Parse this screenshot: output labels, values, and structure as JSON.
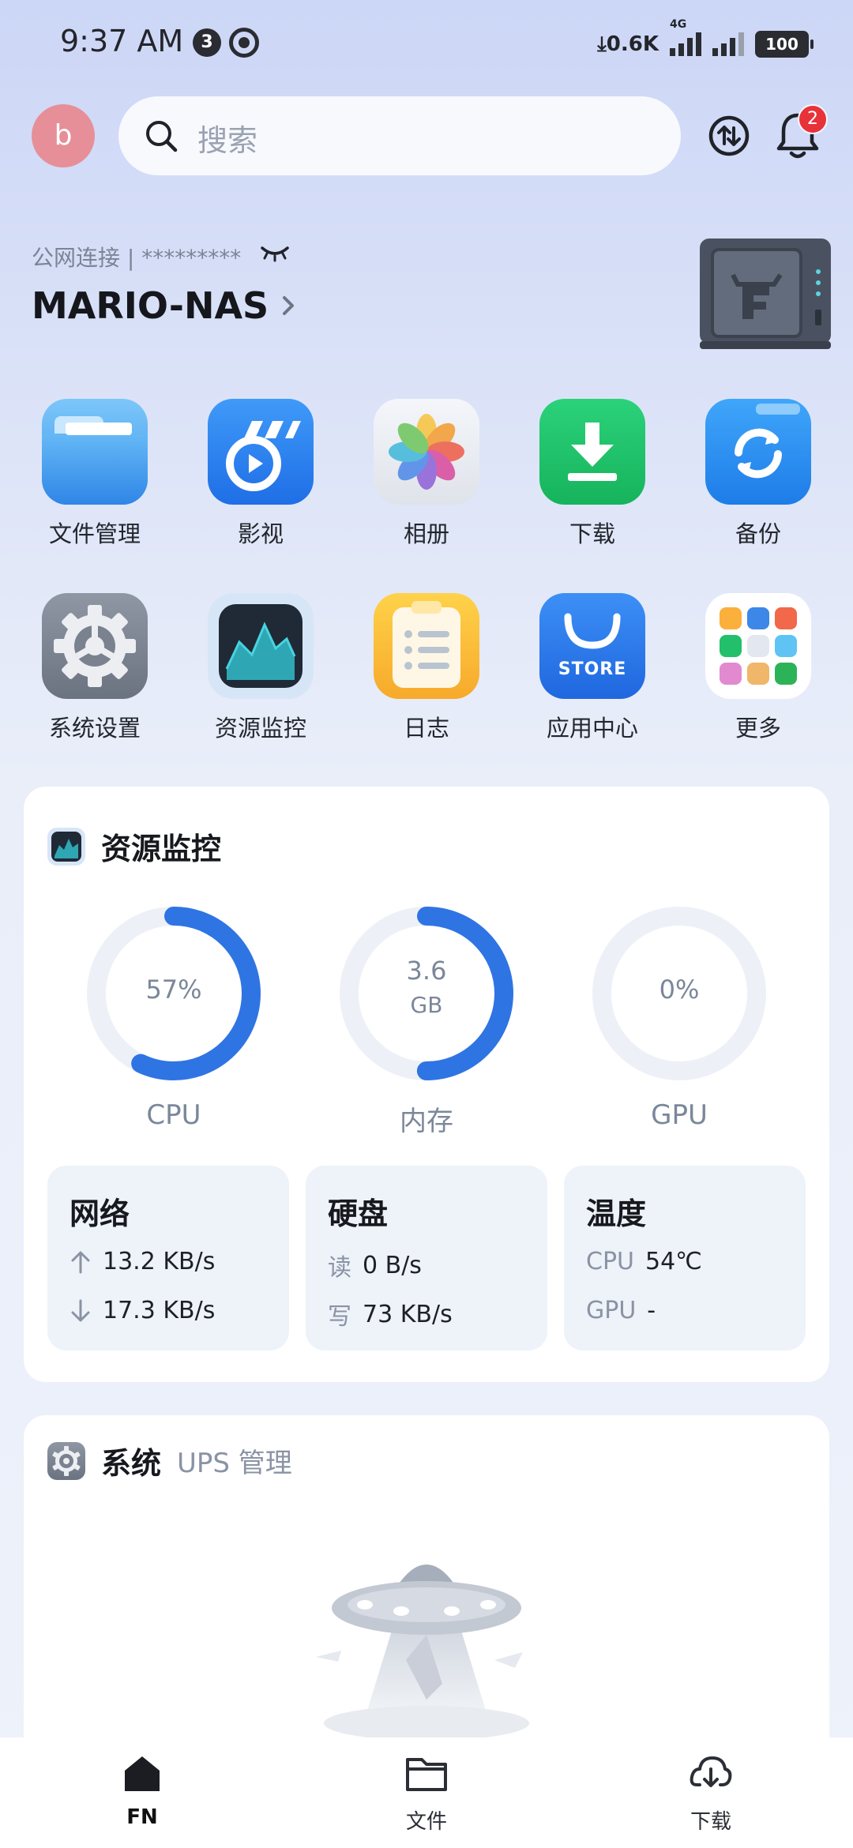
{
  "status_bar": {
    "time": "9:37 AM",
    "notif_count": "3",
    "net_speed": "0.6K",
    "network_type": "4G",
    "battery": "100"
  },
  "header": {
    "avatar_letter": "b",
    "search_placeholder": "搜索",
    "notification_count": "2"
  },
  "device": {
    "connection_label": "公网连接 | *********",
    "name": "MARIO-NAS"
  },
  "apps": [
    {
      "label": "文件管理",
      "icon": "folder-icon"
    },
    {
      "label": "影视",
      "icon": "video-icon"
    },
    {
      "label": "相册",
      "icon": "photos-icon"
    },
    {
      "label": "下载",
      "icon": "download-icon"
    },
    {
      "label": "备份",
      "icon": "backup-icon"
    },
    {
      "label": "系统设置",
      "icon": "settings-icon"
    },
    {
      "label": "资源监控",
      "icon": "monitor-icon"
    },
    {
      "label": "日志",
      "icon": "log-icon"
    },
    {
      "label": "应用中心",
      "icon": "store-icon",
      "badge_text": "STORE"
    },
    {
      "label": "更多",
      "icon": "more-icon"
    }
  ],
  "resource_monitor": {
    "title": "资源监控",
    "gauges": [
      {
        "label": "CPU",
        "value_text": "57%",
        "fraction": 0.57
      },
      {
        "label": "内存",
        "value_line1": "3.6",
        "value_line2": "GB",
        "fraction": 0.5
      },
      {
        "label": "GPU",
        "value_text": "0%",
        "fraction": 0.0
      }
    ],
    "network": {
      "title": "网络",
      "up": "13.2 KB/s",
      "down": "17.3 KB/s"
    },
    "disk": {
      "title": "硬盘",
      "read_key": "读",
      "read": "0 B/s",
      "write_key": "写",
      "write": "73 KB/s"
    },
    "temperature": {
      "title": "温度",
      "cpu_key": "CPU",
      "cpu": "54℃",
      "gpu_key": "GPU",
      "gpu": "-"
    }
  },
  "system": {
    "title": "系统",
    "subtitle": "UPS 管理"
  },
  "tabbar": [
    {
      "label": "FN",
      "active": true
    },
    {
      "label": "文件",
      "active": false
    },
    {
      "label": "下载",
      "active": false
    }
  ],
  "colors": {
    "accent": "#2f74e3",
    "gauge_track": "#edf1f7"
  }
}
